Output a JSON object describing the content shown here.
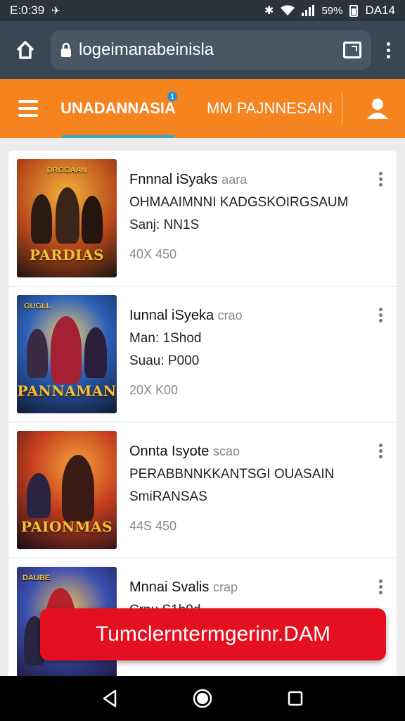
{
  "status_bar": {
    "time": "E:0:39",
    "battery_text": "59%",
    "right_text": "DA14"
  },
  "browser": {
    "url": "logeimanabeinisla"
  },
  "app_bar": {
    "tab_active": "UNADANNASIA",
    "tab_active_badge": "1",
    "tab_second": "MM PAJNNESAIN"
  },
  "items": [
    {
      "title": "Fnnnal iSyaks",
      "title_tag": "aara",
      "line1": "OHMAAIMNNI KADGSKOIRGSAUM",
      "line2": "Sanj: NN1S",
      "meta": "40X 450",
      "poster_title": "PARDIAS",
      "poster_top": "DRGGAAN",
      "poster_colors": [
        "#f0a22b",
        "#7a2c12",
        "#1b1410"
      ]
    },
    {
      "title": "Iunnal iSyeka",
      "title_tag": "crao",
      "line1": "Man: 1Shod",
      "line2": "Suau: P000",
      "meta": "20X K00",
      "poster_title": "PANNAMAN",
      "poster_top": "GUGLL",
      "poster_colors": [
        "#2c5fb8",
        "#a42032",
        "#111a33"
      ]
    },
    {
      "title": "Onnta Isyote",
      "title_tag": "scao",
      "line1": "PERABBNNKKANTSGI OUASAIN",
      "line2": "SmiRANSAS",
      "meta": "44S 450",
      "poster_title": "PAIONMAS",
      "poster_top": "",
      "poster_colors": [
        "#e0642a",
        "#5a1a14",
        "#140d18"
      ]
    },
    {
      "title": "Mnnai Svalis",
      "title_tag": "crap",
      "line1": "Crnu S1h0d",
      "line2": "",
      "meta": "",
      "poster_title": "",
      "poster_top": "DAUBE",
      "poster_colors": [
        "#3a4eb0",
        "#b7232a",
        "#1a1230"
      ]
    }
  ],
  "snackbar": {
    "text": "Tumclerntermgerinr.DAM"
  },
  "nav": {
    "icons": [
      "back-icon",
      "home-circle-icon",
      "recents-square-icon"
    ]
  }
}
